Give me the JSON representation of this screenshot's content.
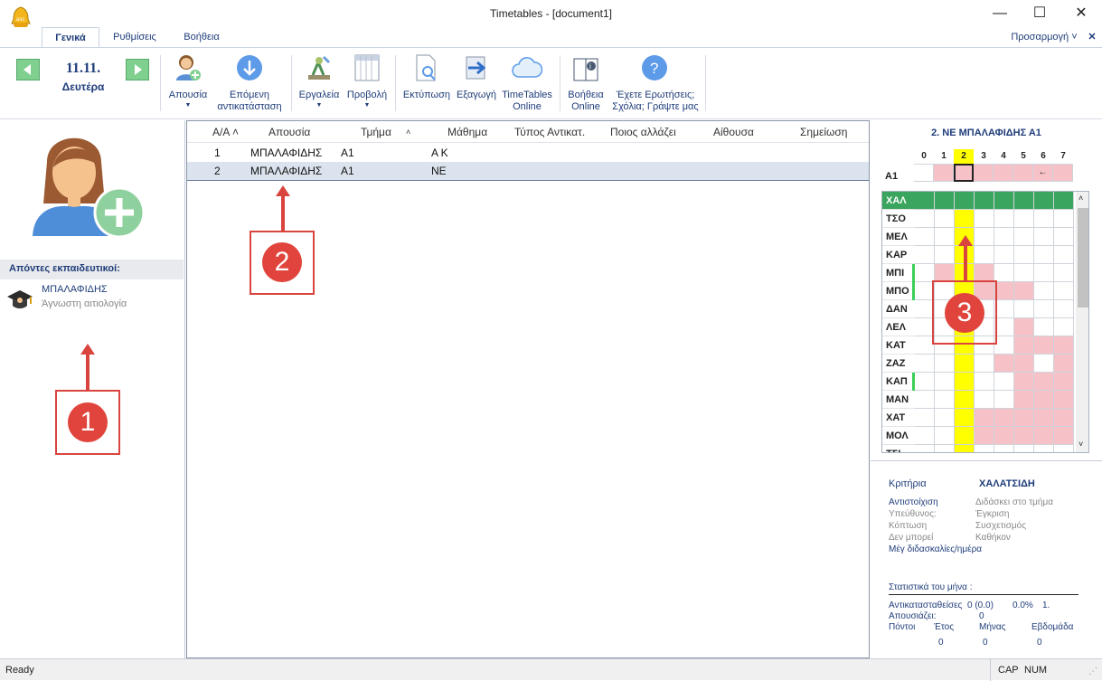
{
  "window": {
    "title": "Timetables - [document1]",
    "minimize": "—",
    "maximize": "☐",
    "close": "✕"
  },
  "tabs": [
    {
      "label": "Γενικά"
    },
    {
      "label": "Ρυθμίσεις"
    },
    {
      "label": "Βοήθεια"
    }
  ],
  "customize": {
    "label": "Προσαρμογή ˅",
    "close": "✕"
  },
  "ribbon": {
    "date": "11.11.",
    "day": "Δευτέρα",
    "absence": "Απουσία",
    "next_line1": "Επόμενη",
    "next_line2": "αντικατάσταση",
    "tools": "Εργαλεία",
    "view": "Προβολή",
    "print": "Εκτύπωση",
    "export": "Εξαγωγή",
    "online_line1": "TimeTables",
    "online_line2": "Online",
    "help_line1": "Βοήθεια",
    "help_line2": "Online",
    "questions_line1": "Έχετε Ερωτήσεις;",
    "questions_line2": "Σχόλια; Γράψτε μας"
  },
  "left": {
    "header": "Απόντες εκπαιδευτικοί:",
    "teacher_name": "ΜΠΑΛΑΦΙΔΗΣ",
    "teacher_reason": "Άγνωστη αιτιολογία"
  },
  "grid": {
    "columns": [
      "Α/Α ˄",
      "Απουσία",
      "Τμήμα",
      "˄",
      "Μάθημα",
      "Τύπος Αντικατ.",
      "Ποιος αλλάζει",
      "Αίθουσα",
      "Σημείωση"
    ],
    "rows": [
      {
        "n": "1",
        "absence": "ΜΠΑΛΑΦΙΔΗΣ",
        "class": "Α1",
        "subject": "Α Κ"
      },
      {
        "n": "2",
        "absence": "ΜΠΑΛΑΦΙΔΗΣ",
        "class": "Α1",
        "subject": "ΝΕ"
      }
    ]
  },
  "timetable": {
    "title": "2. ΝΕ ΜΠΑΛΑΦΙΔΗΣ Α1",
    "periods": [
      "0",
      "1",
      "2",
      "3",
      "4",
      "5",
      "6",
      "7"
    ],
    "class_row": "Α1",
    "class_pink": [
      1,
      1,
      1,
      1,
      1,
      1,
      1
    ],
    "arrow": "←",
    "teachers": [
      {
        "name": "ΧΑΛ",
        "mark": false,
        "cells": "gggggggg"
      },
      {
        "name": "ΤΣΟ",
        "mark": false,
        "cells": "........"
      },
      {
        "name": "ΜΕΛ",
        "mark": false,
        "cells": "........"
      },
      {
        "name": "ΚΑΡ",
        "mark": false,
        "cells": "........"
      },
      {
        "name": "ΜΠΙ",
        "mark": true,
        "cells": ".ppp...."
      },
      {
        "name": "ΜΠΟ",
        "mark": true,
        "cells": "...ppp.."
      },
      {
        "name": "ΔΑΝ",
        "mark": false,
        "cells": "........"
      },
      {
        "name": "ΛΕΛ",
        "mark": false,
        "cells": ".....p.."
      },
      {
        "name": "ΚΑΤ",
        "mark": false,
        "cells": ".....ppp"
      },
      {
        "name": "ΖΑΖ",
        "mark": false,
        "cells": "....pp.p"
      },
      {
        "name": "ΚΑΠ",
        "mark": true,
        "cells": ".....ppp"
      },
      {
        "name": "ΜΑΝ",
        "mark": false,
        "cells": ".....ppp"
      },
      {
        "name": "ΧΑΤ",
        "mark": false,
        "cells": "...ppppp"
      },
      {
        "name": "ΜΟΛ",
        "mark": false,
        "cells": "...ppppp"
      },
      {
        "name": "ΤΣΙ",
        "mark": false,
        "cells": "........"
      }
    ]
  },
  "criteria": {
    "label": "Κριτήρια",
    "teacher": "ΧΑΛΑΤΣΙΔΗ",
    "left": [
      "Αντιστοίχιση",
      "Υπεύθυνος:",
      "Κόπτωση",
      "Δεν μπορεί",
      "Μέγ διδασκαλίες/ημέρα"
    ],
    "right": [
      "Διδάσκει στο τμήμα",
      "Έγκριση",
      "Συσχετισμός",
      "Καθήκον"
    ]
  },
  "stats": {
    "title": "Στατιστικά του μήνα :",
    "replaced_label": "Αντικατασταθείσες",
    "replaced_value": "0 (0.0)",
    "pct": "0.0%",
    "rank": "1.",
    "absent_label": "Απουσιάζει:",
    "absent_value": "0",
    "points_label": "Πόντοι",
    "year_label": "Έτος",
    "month_label": "Μήνας",
    "week_label": "Εβδομάδα",
    "year_value": "0",
    "month_value": "0",
    "week_value": "0"
  },
  "annotations": [
    "1",
    "2",
    "3"
  ],
  "status": {
    "ready": "Ready",
    "cap": "CAP",
    "num": "NUM"
  },
  "colors": {
    "accent": "#1f3d7a",
    "callout": "#d9443f",
    "highlight": "#ffff00",
    "busy": "#f6c2c8",
    "current": "#3aa55e"
  }
}
